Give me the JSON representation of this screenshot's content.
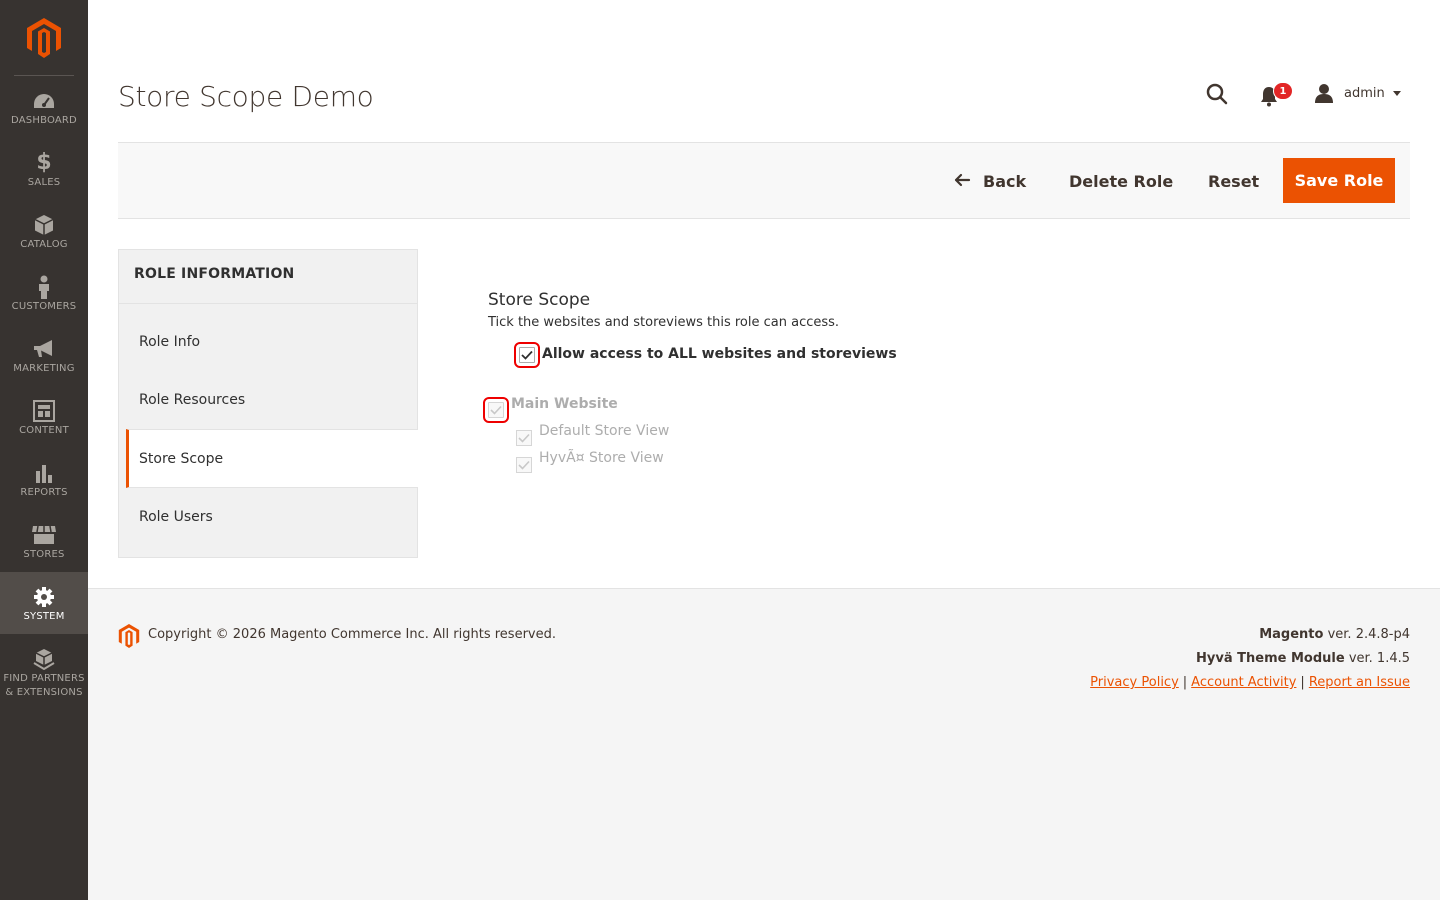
{
  "sidebar": {
    "logo": "magento-logo-icon",
    "items": [
      {
        "label": "DASHBOARD",
        "icon": "dashboard-icon"
      },
      {
        "label": "SALES",
        "icon": "dollar-icon"
      },
      {
        "label": "CATALOG",
        "icon": "box-icon"
      },
      {
        "label": "CUSTOMERS",
        "icon": "person-icon"
      },
      {
        "label": "MARKETING",
        "icon": "megaphone-icon"
      },
      {
        "label": "CONTENT",
        "icon": "content-icon"
      },
      {
        "label": "REPORTS",
        "icon": "bar-chart-icon"
      },
      {
        "label": "STORES",
        "icon": "store-icon"
      },
      {
        "label": "SYSTEM",
        "icon": "gear-icon"
      },
      {
        "label": "FIND PARTNERS & EXTENSIONS",
        "icon": "cubes-icon"
      }
    ],
    "active": "SYSTEM"
  },
  "header": {
    "title": "Store Scope Demo",
    "notifications_count": "1",
    "user_name": "admin"
  },
  "actions": {
    "back_label": "Back",
    "delete_label": "Delete Role",
    "reset_label": "Reset",
    "save_label": "Save Role"
  },
  "tabs": {
    "title": "ROLE INFORMATION",
    "items": [
      "Role Info",
      "Role Resources",
      "Store Scope",
      "Role Users"
    ],
    "active": "Store Scope"
  },
  "store_scope": {
    "title": "Store Scope",
    "description": "Tick the websites and storeviews this role can access.",
    "all_access_label": "Allow access to ALL websites and storeviews",
    "all_access_checked": true,
    "website_label": "Main Website",
    "store_views": [
      "Default Store View",
      "HyvÃ¤ Store View"
    ]
  },
  "footer": {
    "copyright": "Copyright © 2026 Magento Commerce Inc. All rights reserved.",
    "magento_name": "Magento",
    "magento_version": "ver. 2.4.8-p4",
    "hyva_name": "Hyvä Theme Module",
    "hyva_version": "ver. 1.4.5",
    "links": [
      "Privacy Policy",
      "Account Activity",
      "Report an Issue"
    ]
  },
  "colors": {
    "accent": "#eb5202",
    "sidebar_bg": "#373330",
    "sidebar_active": "#524d49",
    "badge": "#e22626",
    "highlight": "#e00000"
  }
}
